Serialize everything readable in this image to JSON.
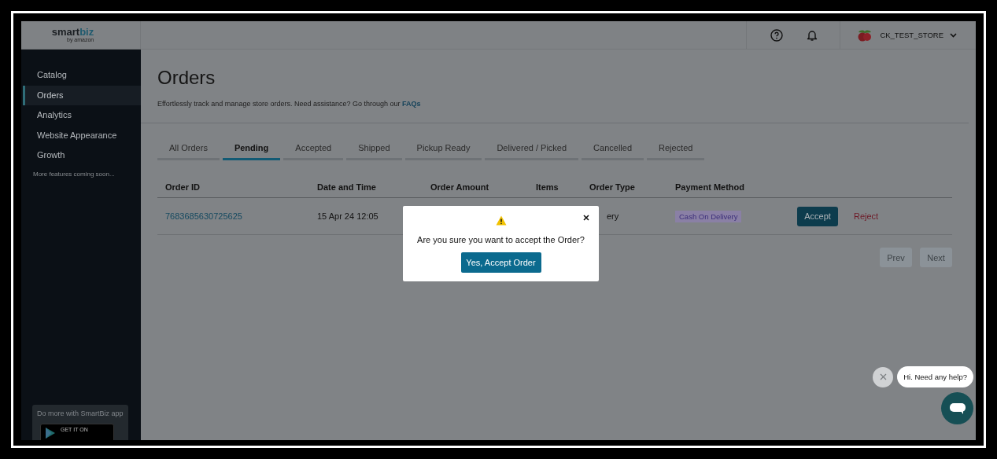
{
  "logo": {
    "primary": "smart",
    "accent": "biz",
    "byline": "by amazon"
  },
  "topbar": {
    "store_name": "CK_TEST_STORE"
  },
  "sidebar": {
    "items": [
      {
        "label": "Catalog",
        "selected": false
      },
      {
        "label": "Orders",
        "selected": true
      },
      {
        "label": "Analytics",
        "selected": false
      },
      {
        "label": "Website Appearance",
        "selected": false
      },
      {
        "label": "Growth",
        "selected": false
      }
    ],
    "note": "More features coming soon...",
    "app_card": {
      "text": "Do more with SmartBiz app",
      "badge": "GET IT ON"
    }
  },
  "page": {
    "title": "Orders",
    "subtitle": "Effortlessly track and manage store orders. Need assistance? Go through our",
    "link": "FAQs"
  },
  "tabs": [
    {
      "label": "All Orders",
      "selected": false
    },
    {
      "label": "Pending",
      "selected": true
    },
    {
      "label": "Accepted",
      "selected": false
    },
    {
      "label": "Shipped",
      "selected": false
    },
    {
      "label": "Pickup Ready",
      "selected": false
    },
    {
      "label": "Delivered / Picked",
      "selected": false
    },
    {
      "label": "Cancelled",
      "selected": false
    },
    {
      "label": "Rejected",
      "selected": false
    }
  ],
  "table": {
    "columns": [
      "Order ID",
      "Date and Time",
      "Order Amount",
      "Items",
      "Order Type",
      "Payment Method"
    ],
    "rows": [
      {
        "order_id": "7683685630725625",
        "date_time": "15 Apr 24 12:05",
        "order_type": "ery",
        "payment_method": "Cash On Delivery",
        "actions": [
          "Accept",
          "Reject"
        ]
      }
    ]
  },
  "pagination": [
    {
      "label": "Prev",
      "disabled": true
    },
    {
      "label": "Next",
      "disabled": true
    }
  ],
  "dialog": {
    "message": "Are you sure you want to accept the Order?",
    "confirm": "Yes, Accept Order"
  },
  "chat": {
    "bubble": "Hi. Need any help?"
  }
}
